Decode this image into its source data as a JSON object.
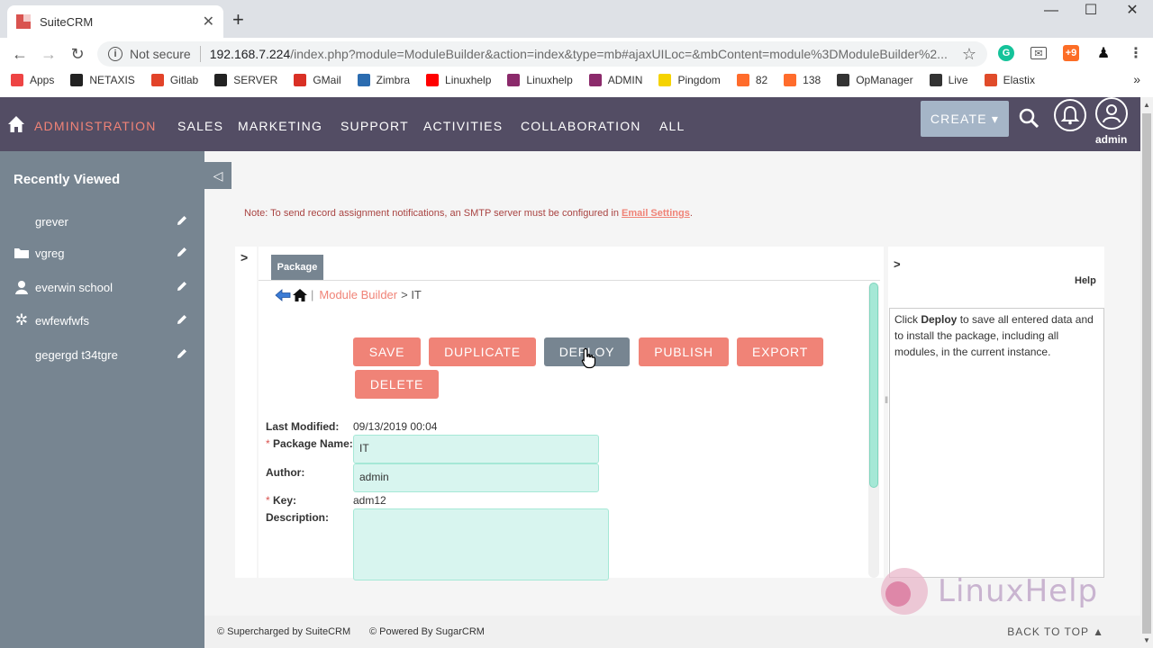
{
  "browser": {
    "tab_title": "SuiteCRM",
    "tab_close": "✕",
    "new_tab": "+",
    "not_secure": "Not secure",
    "url_host": "192.168.7.224",
    "url_path": "/index.php?module=ModuleBuilder&action=index&type=mb#ajaxUILoc=&mbContent=module%3DModuleBuilder%2...",
    "bookmarks": [
      {
        "label": "Apps",
        "icon": "apps-grid-icon",
        "color": "#e44"
      },
      {
        "label": "NETAXIS",
        "icon": "netaxis-icon",
        "color": "#222"
      },
      {
        "label": "Gitlab",
        "icon": "gitlab-icon",
        "color": "#e24329"
      },
      {
        "label": "SERVER",
        "icon": "server-icon",
        "color": "#222"
      },
      {
        "label": "GMail",
        "icon": "gmail-icon",
        "color": "#d93025"
      },
      {
        "label": "Zimbra",
        "icon": "zimbra-icon",
        "color": "#2b6cb0"
      },
      {
        "label": "Linuxhelp",
        "icon": "youtube-icon",
        "color": "#ff0000"
      },
      {
        "label": "Linuxhelp",
        "icon": "linuxhelp-icon",
        "color": "#8b2a6b"
      },
      {
        "label": "ADMIN",
        "icon": "admin-icon",
        "color": "#8b2a6b"
      },
      {
        "label": "Pingdom",
        "icon": "pingdom-icon",
        "color": "#f5d300"
      },
      {
        "label": "82",
        "icon": "cpanel-icon",
        "color": "#ff6c2c"
      },
      {
        "label": "138",
        "icon": "cpanel-icon",
        "color": "#ff6c2c"
      },
      {
        "label": "OpManager",
        "icon": "opmanager-icon",
        "color": "#333"
      },
      {
        "label": "Live",
        "icon": "manageengine-icon",
        "color": "#333"
      },
      {
        "label": "Elastix",
        "icon": "elastix-icon",
        "color": "#e04b2a"
      }
    ],
    "bookmarks_more": "»"
  },
  "nav": {
    "items": [
      "ADMINISTRATION",
      "SALES",
      "MARKETING",
      "SUPPORT",
      "ACTIVITIES",
      "COLLABORATION",
      "ALL"
    ],
    "create_label": "CREATE",
    "user_label": "admin",
    "active_color": "#f08377",
    "bar_color": "#534d64"
  },
  "sidebar": {
    "title": "Recently Viewed",
    "toggle": "◁",
    "items": [
      {
        "label": "grever",
        "icon": ""
      },
      {
        "label": "vgreg",
        "icon": "folder-icon"
      },
      {
        "label": "everwin school",
        "icon": "user-icon"
      },
      {
        "label": "ewfewfwfs",
        "icon": "gear-icon"
      },
      {
        "label": "gegergd t34tgre",
        "icon": ""
      }
    ]
  },
  "main": {
    "note_prefix": "Note: To send record assignment notifications, an SMTP server must be configured in ",
    "note_link": "Email Settings",
    "note_suffix": ".",
    "left_chevron": ">",
    "package_tab": "Package",
    "breadcrumb": {
      "sep": "|",
      "link": "Module Builder",
      "current": "> IT"
    },
    "buttons": {
      "save": "SAVE",
      "duplicate": "DUPLICATE",
      "deploy": "DEPLOY",
      "publish": "PUBLISH",
      "export": "EXPORT",
      "delete": "DELETE"
    },
    "fields": {
      "last_modified_label": "Last Modified:",
      "last_modified_value": "09/13/2019 00:04",
      "required_mark": "*",
      "package_name_label": "Package Name:",
      "package_name_value": "IT",
      "author_label": "Author:",
      "author_value": "admin",
      "key_label": "Key:",
      "key_value": "adm12",
      "description_label": "Description:",
      "description_value": ""
    }
  },
  "help": {
    "chevron": ">",
    "title": "Help",
    "text_pre": "Click ",
    "text_bold": "Deploy",
    "text_post": " to save all entered data and to install the package, including all modules, in the current instance."
  },
  "watermark": "LinuxHelp",
  "footer": {
    "supercharged": "© Supercharged by SuiteCRM",
    "powered": "© Powered By SugarCRM",
    "back_to_top": "BACK TO TOP ▲"
  }
}
